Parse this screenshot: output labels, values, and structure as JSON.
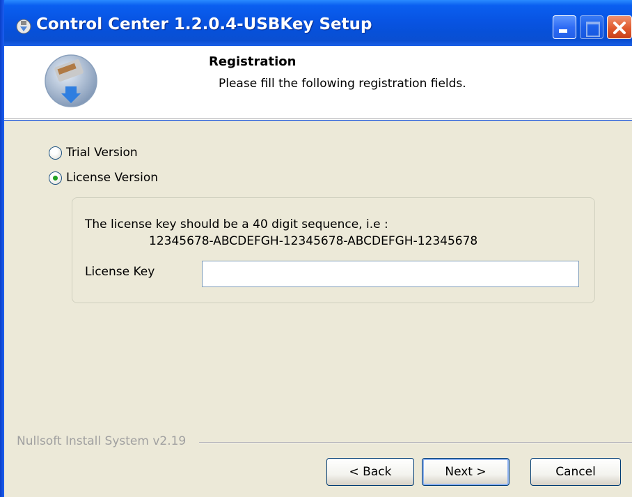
{
  "window": {
    "title": "Control Center 1.2.0.4-USBKey Setup"
  },
  "header": {
    "title": "Registration",
    "subtitle": "Please fill the following registration fields."
  },
  "options": [
    {
      "label": "Trial Version",
      "selected": false
    },
    {
      "label": "License Version",
      "selected": true
    }
  ],
  "license": {
    "info_line1": "The license key should be a 40 digit sequence, i.e :",
    "info_line2": "12345678-ABCDEFGH-12345678-ABCDEFGH-12345678",
    "key_label": "License Key",
    "key_value": ""
  },
  "footer": {
    "brand": "Nullsoft Install System v2.19",
    "back_label": "< Back",
    "next_label": "Next >",
    "cancel_label": "Cancel"
  },
  "colors": {
    "titlebar": "#0a4be0",
    "panel": "#ece9d8",
    "radio_dot": "#21a121"
  },
  "icons": {
    "title": "installer-icon",
    "header": "usb-install-icon"
  }
}
